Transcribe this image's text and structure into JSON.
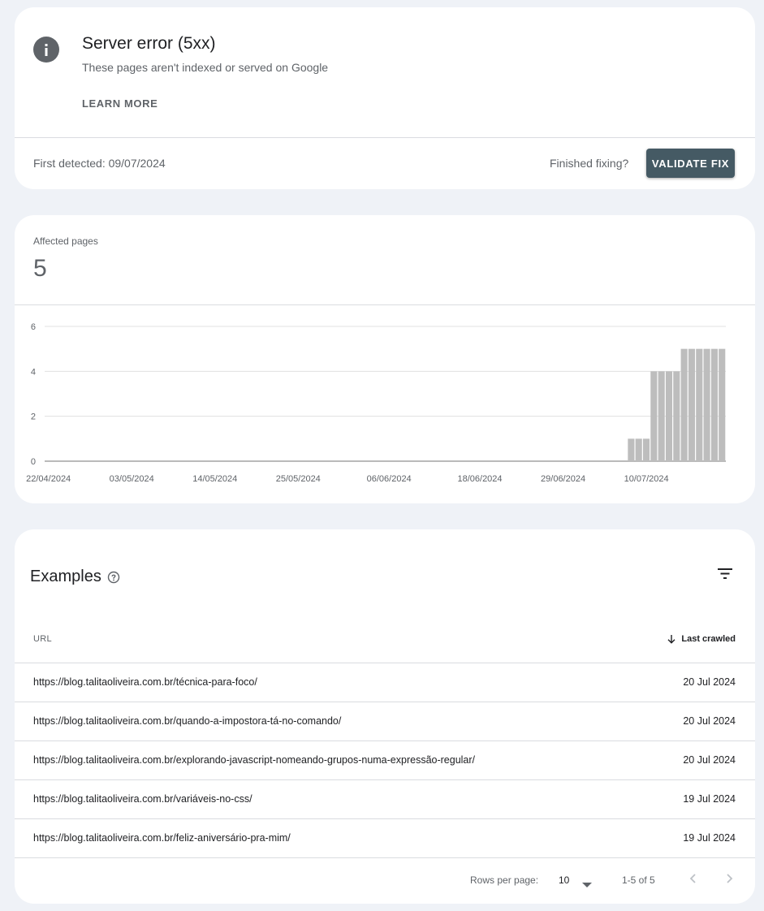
{
  "issue": {
    "title": "Server error (5xx)",
    "subtitle": "These pages aren't indexed or served on Google",
    "learn_more": "LEARN MORE",
    "first_detected": "First detected: 09/07/2024",
    "finished_fixing": "Finished fixing?",
    "validate_fix": "VALIDATE FIX"
  },
  "affected": {
    "label": "Affected pages",
    "value": "5"
  },
  "chart_data": {
    "type": "bar",
    "ylim": [
      0,
      6
    ],
    "yticks": [
      0,
      2,
      4,
      6
    ],
    "xtick_labels": [
      "22/04/2024",
      "03/05/2024",
      "14/05/2024",
      "25/05/2024",
      "06/06/2024",
      "18/06/2024",
      "29/06/2024",
      "10/07/2024"
    ],
    "x": [
      "22/04/2024",
      "23/04/2024",
      "24/04/2024",
      "25/04/2024",
      "26/04/2024",
      "27/04/2024",
      "28/04/2024",
      "29/04/2024",
      "30/04/2024",
      "01/05/2024",
      "02/05/2024",
      "03/05/2024",
      "04/05/2024",
      "05/05/2024",
      "06/05/2024",
      "07/05/2024",
      "08/05/2024",
      "09/05/2024",
      "10/05/2024",
      "11/05/2024",
      "12/05/2024",
      "13/05/2024",
      "14/05/2024",
      "15/05/2024",
      "16/05/2024",
      "17/05/2024",
      "18/05/2024",
      "19/05/2024",
      "20/05/2024",
      "21/05/2024",
      "22/05/2024",
      "23/05/2024",
      "24/05/2024",
      "25/05/2024",
      "26/05/2024",
      "27/05/2024",
      "28/05/2024",
      "29/05/2024",
      "30/05/2024",
      "31/05/2024",
      "01/06/2024",
      "02/06/2024",
      "03/06/2024",
      "04/06/2024",
      "05/06/2024",
      "06/06/2024",
      "07/06/2024",
      "08/06/2024",
      "09/06/2024",
      "10/06/2024",
      "11/06/2024",
      "12/06/2024",
      "13/06/2024",
      "14/06/2024",
      "15/06/2024",
      "16/06/2024",
      "17/06/2024",
      "18/06/2024",
      "19/06/2024",
      "20/06/2024",
      "21/06/2024",
      "22/06/2024",
      "23/06/2024",
      "24/06/2024",
      "25/06/2024",
      "26/06/2024",
      "27/06/2024",
      "28/06/2024",
      "29/06/2024",
      "30/06/2024",
      "01/07/2024",
      "02/07/2024",
      "03/07/2024",
      "04/07/2024",
      "05/07/2024",
      "06/07/2024",
      "07/07/2024",
      "08/07/2024",
      "09/07/2024",
      "10/07/2024",
      "11/07/2024",
      "12/07/2024",
      "13/07/2024",
      "14/07/2024",
      "15/07/2024",
      "16/07/2024",
      "17/07/2024",
      "18/07/2024",
      "19/07/2024",
      "20/07/2024"
    ],
    "values": [
      0,
      0,
      0,
      0,
      0,
      0,
      0,
      0,
      0,
      0,
      0,
      0,
      0,
      0,
      0,
      0,
      0,
      0,
      0,
      0,
      0,
      0,
      0,
      0,
      0,
      0,
      0,
      0,
      0,
      0,
      0,
      0,
      0,
      0,
      0,
      0,
      0,
      0,
      0,
      0,
      0,
      0,
      0,
      0,
      0,
      0,
      0,
      0,
      0,
      0,
      0,
      0,
      0,
      0,
      0,
      0,
      0,
      0,
      0,
      0,
      0,
      0,
      0,
      0,
      0,
      0,
      0,
      0,
      0,
      0,
      0,
      0,
      0,
      0,
      0,
      0,
      0,
      1,
      1,
      1,
      4,
      4,
      4,
      4,
      5,
      5,
      5,
      5,
      5,
      5
    ],
    "bar_color": "#bdbdbd",
    "grid": true
  },
  "examples": {
    "title": "Examples",
    "col_url": "URL",
    "col_crawled": "Last crawled",
    "rows": [
      {
        "url": "https://blog.talitaoliveira.com.br/técnica-para-foco/",
        "date": "20 Jul 2024"
      },
      {
        "url": "https://blog.talitaoliveira.com.br/quando-a-impostora-tá-no-comando/",
        "date": "20 Jul 2024"
      },
      {
        "url": "https://blog.talitaoliveira.com.br/explorando-javascript-nomeando-grupos-numa-expressão-regular/",
        "date": "20 Jul 2024"
      },
      {
        "url": "https://blog.talitaoliveira.com.br/variáveis-no-css/",
        "date": "19 Jul 2024"
      },
      {
        "url": "https://blog.talitaoliveira.com.br/feliz-aniversário-pra-mim/",
        "date": "19 Jul 2024"
      }
    ],
    "rows_per_page_label": "Rows per page:",
    "rows_per_page": "10",
    "range": "1-5 of 5"
  },
  "colors": {
    "page_bg": "#eff2f7",
    "button_bg": "#455a64",
    "icon_gray": "#5f6368"
  }
}
